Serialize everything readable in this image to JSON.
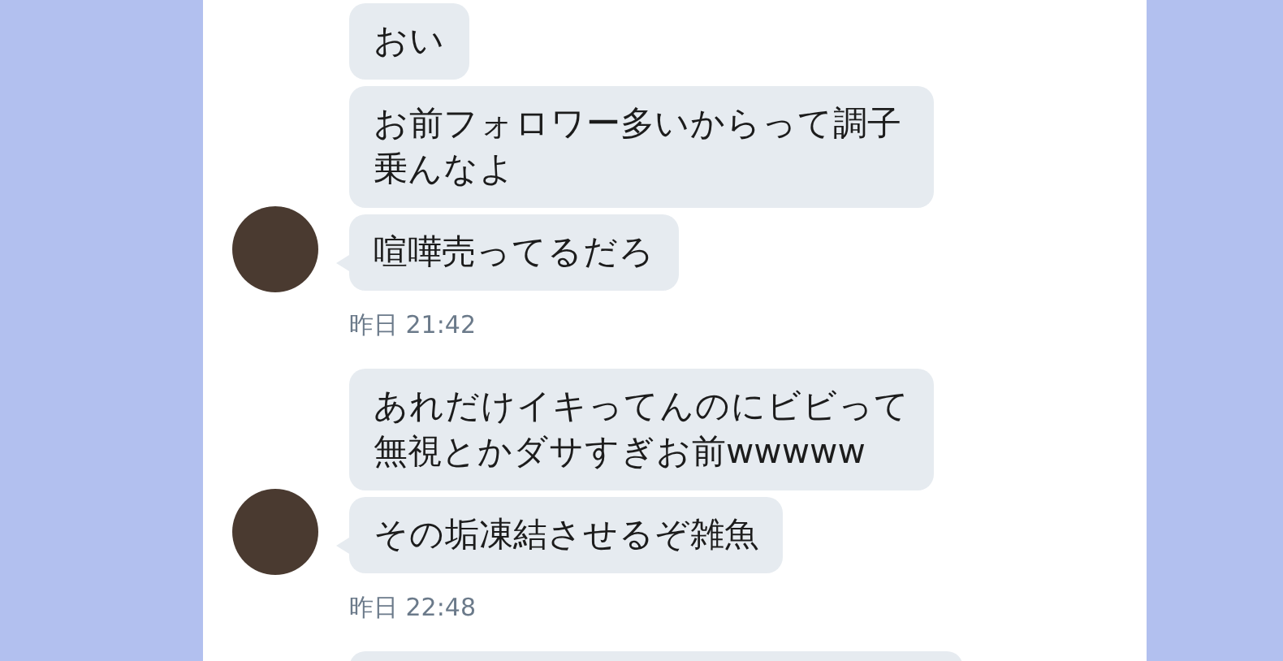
{
  "groups": [
    {
      "messages": [
        "おい",
        "お前フォロワー多いからって調子乗んなよ",
        "喧嘩売ってるだろ"
      ],
      "time": "昨日 21:42"
    },
    {
      "messages": [
        "あれだけイキってんのにビビって無視とかダサすぎお前wwwww",
        "その垢凍結させるぞ雑魚"
      ],
      "time": "昨日 22:48"
    }
  ]
}
